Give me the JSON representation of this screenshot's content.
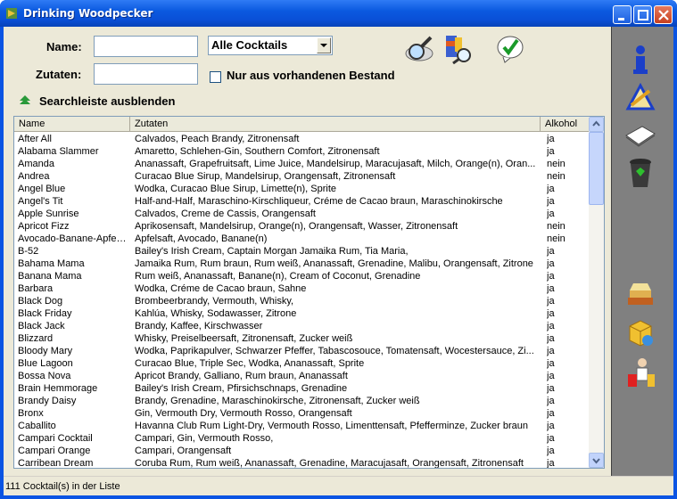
{
  "window": {
    "title": "Drinking Woodpecker",
    "controls": [
      "minimize",
      "maximize",
      "close"
    ]
  },
  "search": {
    "name_label": "Name:",
    "name_value": "",
    "ingredients_label": "Zutaten:",
    "ingredients_value": "",
    "category_selected": "Alle Cocktails",
    "stock_only_label": "Nur aus vorhandenen Bestand",
    "stock_only_checked": false,
    "collapse_label": "Searchleiste ausblenden"
  },
  "toolbar_icons": [
    "search-magnifier-icon",
    "ingredient-search-icon",
    "confirm-check-icon"
  ],
  "right_toolbar": [
    "info-icon",
    "edit-icon",
    "notes-icon",
    "trash-icon",
    "recipe-book-icon",
    "stock-icon",
    "barkeeper-icon"
  ],
  "table": {
    "columns": [
      "Name",
      "Zutaten",
      "Alkohol"
    ],
    "rows": [
      [
        "After All",
        "Calvados, Peach Brandy, Zitronensaft",
        "ja"
      ],
      [
        "Alabama Slammer",
        "Amaretto, Schlehen-Gin, Southern Comfort, Zitronensaft",
        "ja"
      ],
      [
        "Amanda",
        "Ananassaft, Grapefruitsaft, Lime Juice, Mandelsirup, Maracujasaft, Milch, Orange(n), Oran...",
        "nein"
      ],
      [
        "Andrea",
        "Curacao Blue Sirup, Mandelsirup, Orangensaft, Zitronensaft",
        "nein"
      ],
      [
        "Angel Blue",
        "Wodka, Curacao Blue Sirup, Limette(n), Sprite",
        "ja"
      ],
      [
        "Angel's Tit",
        "Half-and-Half, Maraschino-Kirschliqueur, Créme de Cacao braun, Maraschinokirsche",
        "ja"
      ],
      [
        "Apple Sunrise",
        "Calvados, Creme de Cassis, Orangensaft",
        "ja"
      ],
      [
        "Apricot Fizz",
        "Aprikosensaft, Mandelsirup, Orange(n), Orangensaft, Wasser, Zitronensaft",
        "nein"
      ],
      [
        "Avocado-Banane-Apfel...",
        "Apfelsaft, Avocado, Banane(n)",
        "nein"
      ],
      [
        "B-52",
        "Bailey's Irish Cream, Captain Morgan Jamaika Rum, Tia Maria,",
        "ja"
      ],
      [
        "Bahama Mama",
        "Jamaika Rum, Rum braun, Rum weiß, Ananassaft, Grenadine, Malibu, Orangensaft, Zitrone",
        "ja"
      ],
      [
        "Banana Mama",
        "Rum weiß, Ananassaft, Banane(n), Cream of Coconut, Grenadine",
        "ja"
      ],
      [
        "Barbara",
        "Wodka, Créme de Cacao braun, Sahne",
        "ja"
      ],
      [
        "Black Dog",
        "Brombeerbrandy, Vermouth, Whisky,",
        "ja"
      ],
      [
        "Black Friday",
        "Kahlúa, Whisky, Sodawasser, Zitrone",
        "ja"
      ],
      [
        "Black Jack",
        "Brandy, Kaffee, Kirschwasser",
        "ja"
      ],
      [
        "Blizzard",
        "Whisky, Preiselbeersaft, Zitronensaft, Zucker weiß",
        "ja"
      ],
      [
        "Bloody Mary",
        "Wodka, Paprikapulver, Schwarzer Pfeffer, Tabascosouce, Tomatensaft, Wocestersauce, Zi...",
        "ja"
      ],
      [
        "Blue Lagoon",
        "Curacao Blue, Triple Sec, Wodka, Ananassaft, Sprite",
        "ja"
      ],
      [
        "Bossa Nova",
        "Apricot Brandy, Galliano, Rum braun, Ananassaft",
        "ja"
      ],
      [
        "Brain Hemmorage",
        "Bailey's Irish Cream, Pfirsichschnaps, Grenadine",
        "ja"
      ],
      [
        "Brandy Daisy",
        "Brandy, Grenadine, Maraschinokirsche, Zitronensaft, Zucker weiß",
        "ja"
      ],
      [
        "Bronx",
        "Gin, Vermouth Dry, Vermouth Rosso, Orangensaft",
        "ja"
      ],
      [
        "Caballito",
        "Havanna Club Rum Light-Dry, Vermouth Rosso, Limenttensaft, Pfefferminze, Zucker braun",
        "ja"
      ],
      [
        "Campari Cocktail",
        "Campari, Gin, Vermouth Rosso,",
        "ja"
      ],
      [
        "Campari Orange",
        "Campari, Orangensaft",
        "ja"
      ],
      [
        "Carribean Dream",
        "Coruba Rum, Rum weiß, Ananassaft, Grenadine, Maracujasaft, Orangensaft, Zitronensaft",
        "ja"
      ]
    ]
  },
  "status": "111 Cocktail(s) in der Liste"
}
